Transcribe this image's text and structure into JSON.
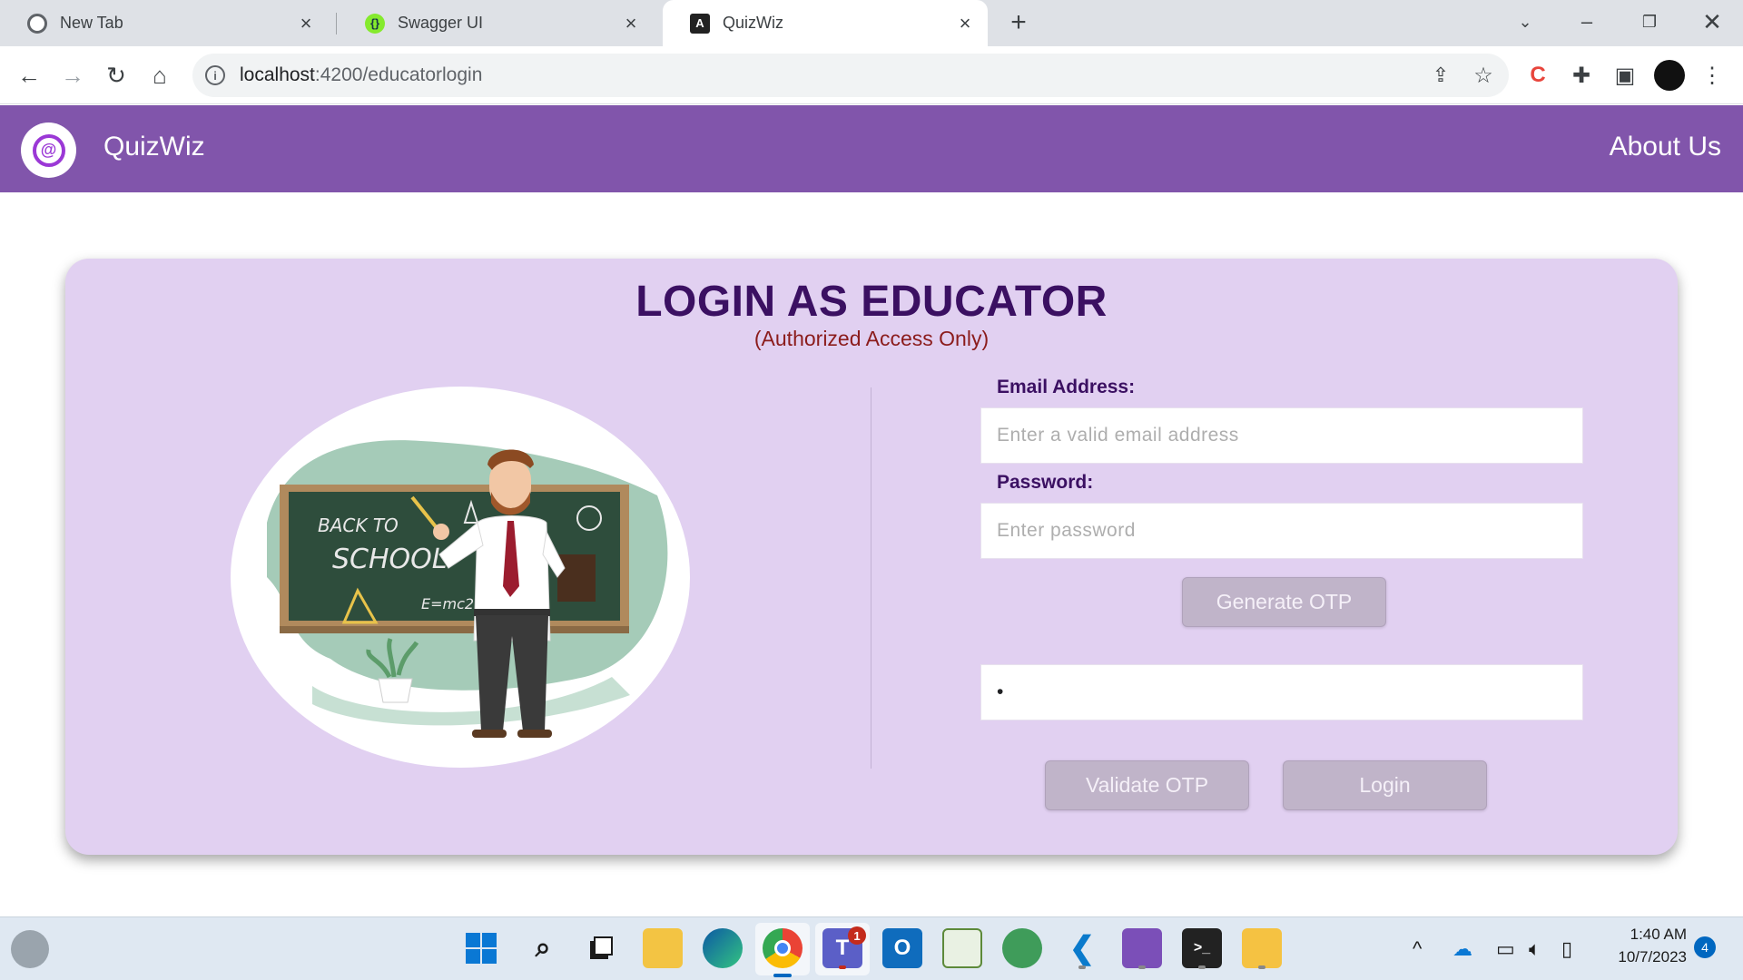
{
  "browser": {
    "tabs": [
      {
        "title": "New Tab",
        "icon": "chrome-icon"
      },
      {
        "title": "Swagger UI",
        "icon": "swagger-icon"
      },
      {
        "title": "QuizWiz",
        "icon": "angular-icon"
      }
    ],
    "url_host": "localhost",
    "url_path": ":4200/educatorlogin"
  },
  "header": {
    "brand": "QuizWiz",
    "about": "About Us",
    "color": "#8155ab"
  },
  "login": {
    "title": "LOGIN AS EDUCATOR",
    "subtitle": "(Authorized Access Only)",
    "email_label": "Email Address:",
    "email_placeholder": "Enter a valid email address",
    "email_value": "",
    "password_label": "Password:",
    "password_placeholder": "Enter password",
    "password_value": "",
    "generate_otp": "Generate OTP",
    "otp_value": "•",
    "validate_otp": "Validate OTP",
    "login_button": "Login",
    "illustration": {
      "board_text_1": "BACK TO",
      "board_text_2": "SCHOOL",
      "board_text_3": "E=mc2"
    }
  },
  "taskbar": {
    "time": "1:40 AM",
    "date": "10/7/2023",
    "teams_badge": "1",
    "notifications": "4"
  }
}
